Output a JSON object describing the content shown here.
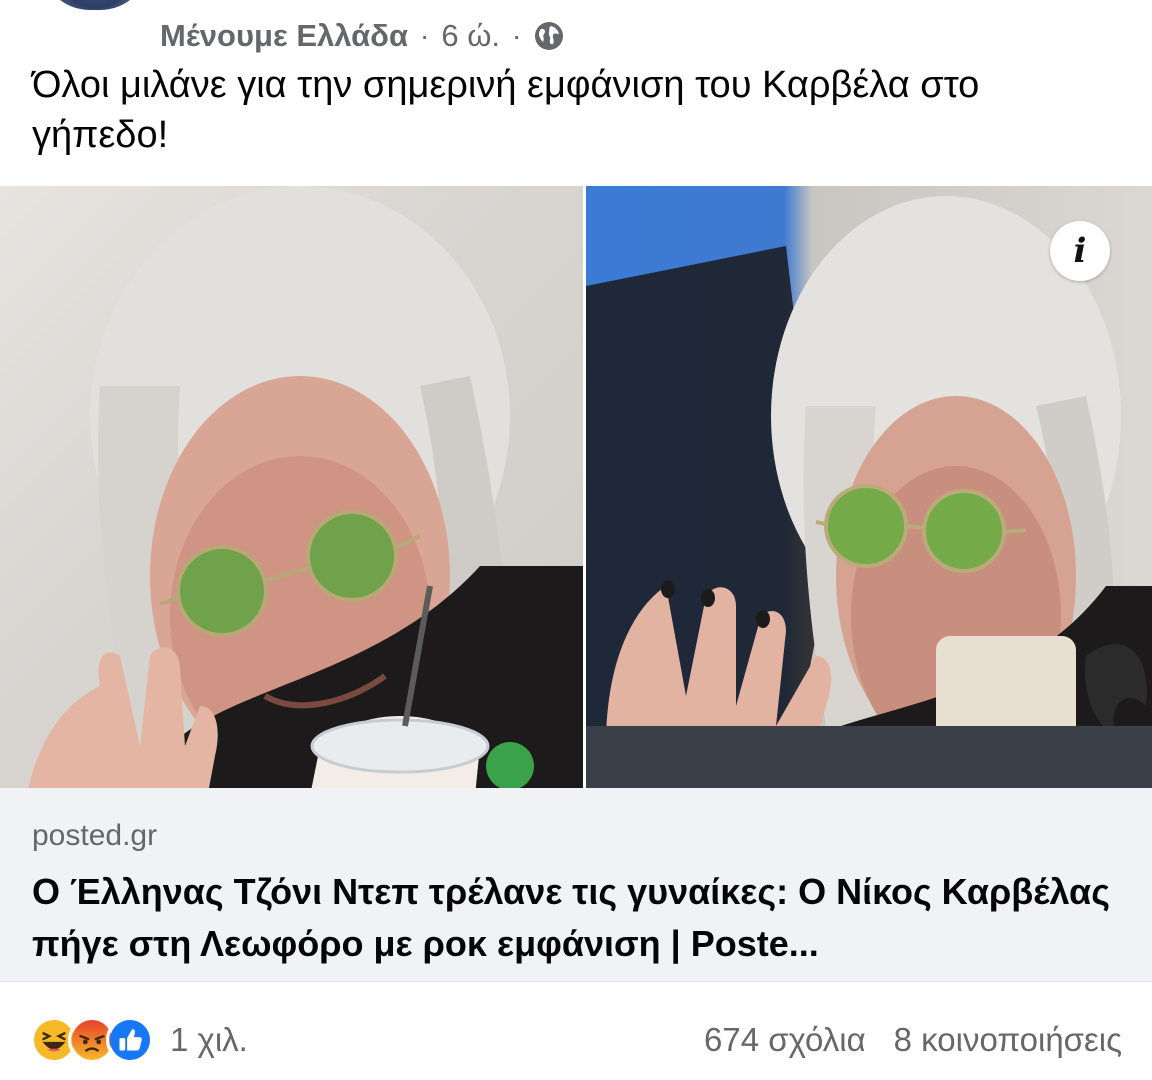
{
  "header": {
    "page_name": "Μένουμε Ελλάδα",
    "separator": "·",
    "time": "6 ώ.",
    "privacy_icon": "globe-icon"
  },
  "post": {
    "text": "Όλοι μιλάνε για την σημερινή εμφάνιση του Καρβέλα στο γήπεδο!"
  },
  "media": {
    "left_photo": "man-with-long-white-hair-green-round-glasses-smiling",
    "right_photo": "man-with-long-white-hair-green-round-glasses-black-nails",
    "info_label": "i"
  },
  "link": {
    "domain": "posted.gr",
    "title": "Ο Έλληνας Τζόνι Ντεπ τρέλανε τις γυναίκες: Ο Νίκος Καρβέλας πήγε στη Λεωφόρο με ροκ εμφάνιση | Poste..."
  },
  "footer": {
    "reactions": [
      "haha-icon",
      "angry-icon",
      "like-icon"
    ],
    "reaction_count": "1 χιλ.",
    "comments": "674 σχόλια",
    "shares": "8 κοινοποιήσεις"
  },
  "colors": {
    "secondary_text": "#65676b",
    "link_bg": "#f0f2f5",
    "like_blue": "#1877f2",
    "haha_yellow": "#f7b928",
    "angry_red": "#e9710f"
  }
}
